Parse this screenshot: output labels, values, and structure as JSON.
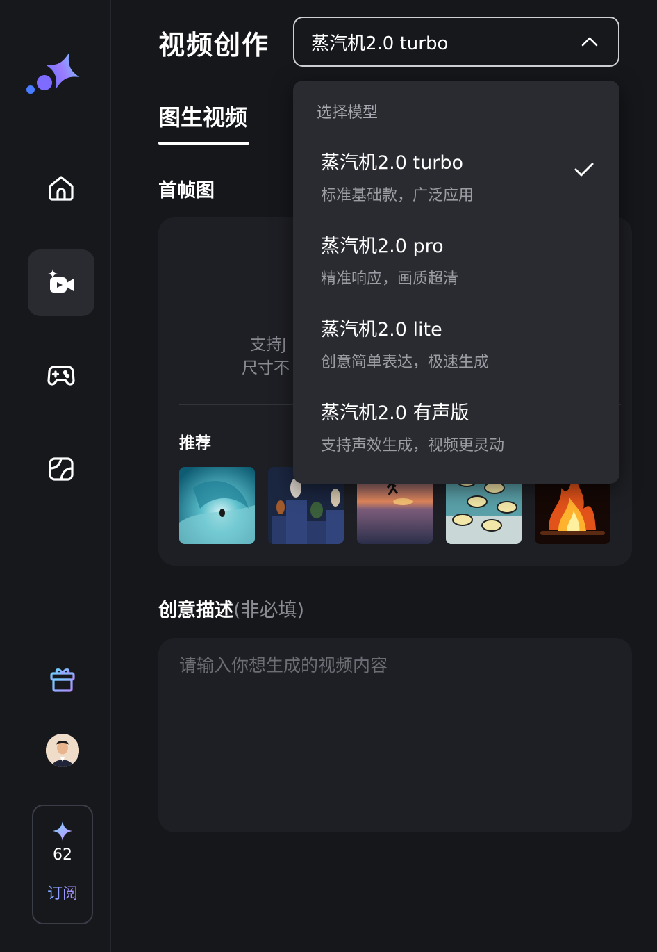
{
  "header": {
    "title": "视频创作",
    "model_select_value": "蒸汽机2.0 turbo"
  },
  "tabs": [
    {
      "label": "图生视频",
      "active": true
    }
  ],
  "upload": {
    "section_label": "首帧图",
    "hint_line1": "支持J",
    "hint_line2": "尺寸不",
    "recommend_label": "推荐",
    "thumbnails": [
      "wave-surf",
      "dogs-statues",
      "sunset-runner",
      "fish-school",
      "bonfire"
    ]
  },
  "description": {
    "label": "创意描述",
    "optional": "(非必填)",
    "placeholder": "请输入你想生成的视频内容"
  },
  "dropdown": {
    "header": "选择模型",
    "options": [
      {
        "name": "蒸汽机2.0 turbo",
        "desc": "标准基础款，广泛应用",
        "selected": true
      },
      {
        "name": "蒸汽机2.0 pro",
        "desc": "精准响应，画质超清",
        "selected": false
      },
      {
        "name": "蒸汽机2.0 lite",
        "desc": "创意简单表达，极速生成",
        "selected": false
      },
      {
        "name": "蒸汽机2.0 有声版",
        "desc": "支持声效生成，视频更灵动",
        "selected": false
      }
    ]
  },
  "sidebar": {
    "nav": [
      "home-icon",
      "video-create-icon",
      "game-icon",
      "gallery-icon"
    ],
    "active_nav": "video-create-icon",
    "credits_count": "62",
    "subscribe_label": "订阅"
  },
  "colors": {
    "background": "#16171b",
    "panel": "#1e1f24",
    "dropdown": "#2a2b31",
    "accent_purple": "#b18cff",
    "accent_blue": "#7aa8ff"
  }
}
